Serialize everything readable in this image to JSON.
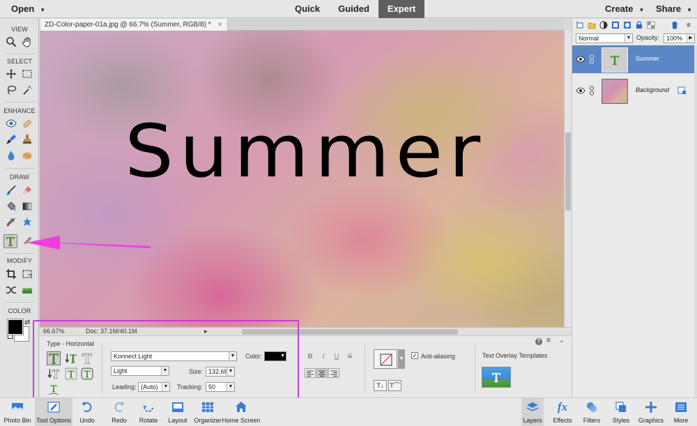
{
  "topbar": {
    "open_label": "Open",
    "modes": [
      "Quick",
      "Guided",
      "Expert"
    ],
    "active_mode": "Expert",
    "create_label": "Create",
    "share_label": "Share"
  },
  "toolbox": {
    "sections": [
      "VIEW",
      "SELECT",
      "ENHANCE",
      "DRAW",
      "MODIFY",
      "COLOR"
    ],
    "selected_tool": "horizontal-type-tool",
    "foreground_color": "#000000",
    "background_color": "#ffffff"
  },
  "document": {
    "tab_title": "ZD-Color-paper-01a.jpg @ 66.7% (Summer, RGB/8) *",
    "tab_close": "×",
    "canvas_text": "Summer",
    "zoom": "66.67%",
    "doc_size": "Doc: 37.1M/40.1M"
  },
  "tool_options": {
    "title": "Type - Horizontal",
    "font_family": "Konnect Light",
    "font_style": "Light",
    "color_label": "Color:",
    "text_color": "#000000",
    "size_label": "Size:",
    "size_value": "132.68",
    "leading_label": "Leading:",
    "leading_value": "(Auto)",
    "tracking_label": "Tracking:",
    "tracking_value": "50",
    "bold_label": "B",
    "italic_label": "I",
    "underline_label": "U",
    "strike_label": "S",
    "anti_aliasing_label": "Anti-aliasing",
    "anti_aliasing_checked": true,
    "overlay_label": "Text Overlay Templates",
    "help_icon": "?",
    "menu_icon": "≡"
  },
  "layers_panel": {
    "blend_mode": "Normal",
    "opacity_label": "Opacity:",
    "opacity_value": "100%",
    "layers": [
      {
        "name": "Summer",
        "selected": true
      },
      {
        "name": "Background",
        "selected": false
      }
    ]
  },
  "bottombar": {
    "left": [
      "Photo Bin",
      "Tool Options",
      "Undo",
      "Redo",
      "Rotate",
      "Layout",
      "Organizer",
      "Home Screen"
    ],
    "right": [
      "Layers",
      "Effects",
      "Filters",
      "Styles",
      "Graphics",
      "More"
    ]
  },
  "annotations": {
    "arrow_color": "#f23ce0",
    "highlight_color": "#c43be0"
  }
}
